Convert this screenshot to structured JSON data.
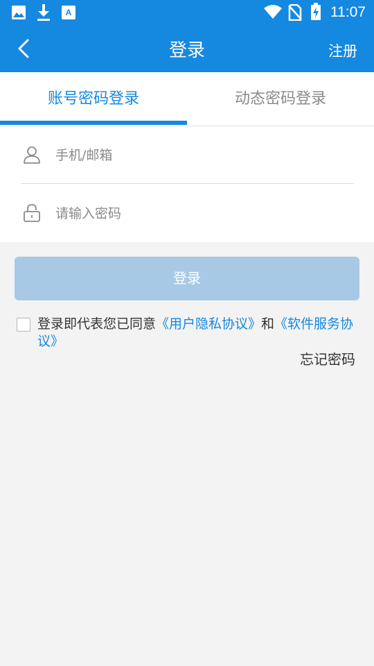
{
  "status_bar": {
    "time": "11:07",
    "icons": [
      "image-icon",
      "download-icon",
      "font-app-icon",
      "wifi-icon",
      "no-sim-icon",
      "battery-charging-icon"
    ]
  },
  "app_bar": {
    "title": "登录",
    "register_label": "注册",
    "back_icon": "chevron-left-icon"
  },
  "tabs": [
    {
      "label": "账号密码登录",
      "active": true
    },
    {
      "label": "动态密码登录",
      "active": false
    }
  ],
  "form": {
    "account": {
      "placeholder": "手机/邮箱",
      "value": "",
      "icon": "user-icon"
    },
    "password": {
      "placeholder": "请输入密码",
      "value": "",
      "icon": "lock-icon"
    }
  },
  "login_button_label": "登录",
  "agreement": {
    "checked": false,
    "prefix": "登录即代表您已同意",
    "privacy_link": "《用户隐私协议》",
    "middle": "和",
    "service_link": "《软件服务协议》"
  },
  "forgot_password_label": "忘记密码",
  "colors": {
    "primary": "#1588e0",
    "disabled_button": "#a7c9e6",
    "background": "#f3f3f3"
  }
}
